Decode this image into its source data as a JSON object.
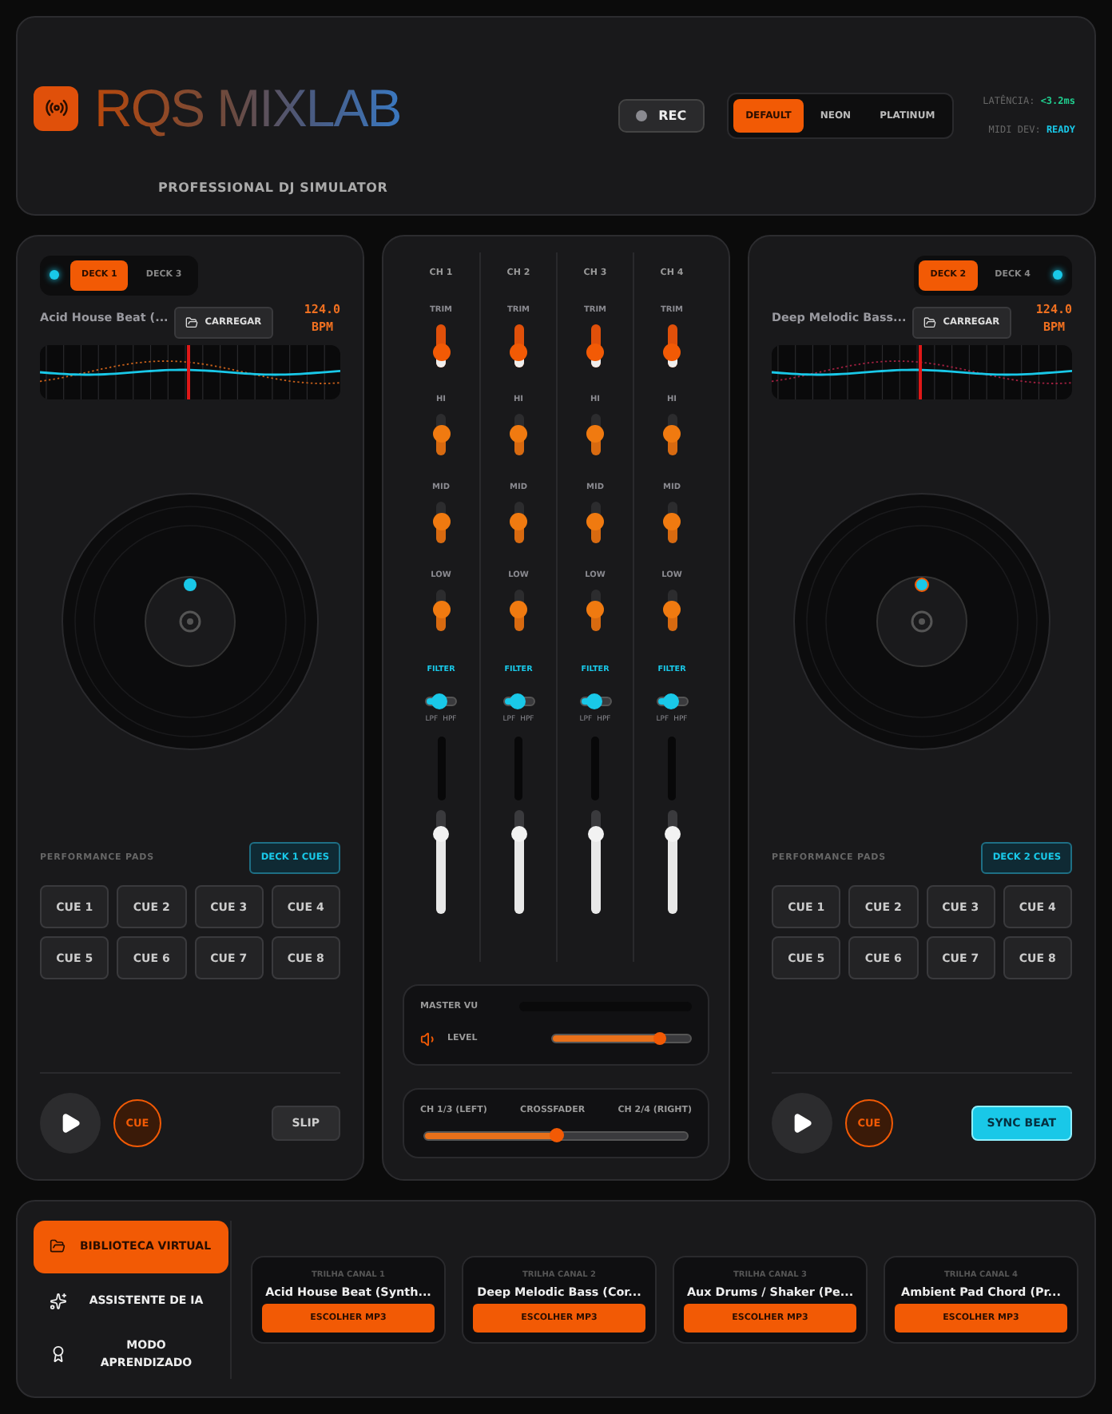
{
  "header": {
    "title": "RQS MIXLAB",
    "subtitle": "PROFESSIONAL DJ SIMULATOR",
    "rec": {
      "label": "REC",
      "recording": false
    },
    "themes": [
      {
        "label": "DEFAULT",
        "selected": true
      },
      {
        "label": "NEON",
        "selected": false
      },
      {
        "label": "PLATINUM",
        "selected": false
      }
    ],
    "latency_label": "LATÊNCIA:",
    "latency_value": "<3.2ms",
    "midi_label": "MIDI DEV:",
    "midi_value": "READY"
  },
  "decks": [
    {
      "tabs": [
        {
          "label": "DECK 1",
          "selected": true
        },
        {
          "label": "DECK 3",
          "selected": false
        }
      ],
      "track": "Acid House Beat (...",
      "load": "CARREGAR",
      "bpm": "124.0",
      "bpm_unit": "BPM",
      "pads_title": "PERFORMANCE PADS",
      "cues_button": "DECK 1 CUES",
      "pads": [
        "CUE 1",
        "CUE 2",
        "CUE 3",
        "CUE 4",
        "CUE 5",
        "CUE 6",
        "CUE 7",
        "CUE 8"
      ],
      "cue": "CUE",
      "action": {
        "label": "SLIP",
        "active": false
      }
    },
    {
      "tabs": [
        {
          "label": "DECK 2",
          "selected": true
        },
        {
          "label": "DECK 4",
          "selected": false
        }
      ],
      "track": "Deep Melodic Bass...",
      "load": "CARREGAR",
      "bpm": "124.0",
      "bpm_unit": "BPM",
      "pads_title": "PERFORMANCE PADS",
      "cues_button": "DECK 2 CUES",
      "pads": [
        "CUE 1",
        "CUE 2",
        "CUE 3",
        "CUE 4",
        "CUE 5",
        "CUE 6",
        "CUE 7",
        "CUE 8"
      ],
      "cue": "CUE",
      "action": {
        "label": "SYNC BEAT",
        "active": true
      }
    }
  ],
  "mixer": {
    "channels": [
      {
        "name": "CH 1",
        "eq": [
          {
            "kind": "trim",
            "label": "TRIM",
            "level": 0.35
          },
          {
            "kind": "eq",
            "label": "HI",
            "level": 0.5
          },
          {
            "kind": "eq",
            "label": "MID",
            "level": 0.5
          },
          {
            "kind": "eq",
            "label": "LOW",
            "level": 0.5
          }
        ],
        "filter": {
          "label": "FILTER",
          "level": 0.45,
          "low": "LPF",
          "high": "HPF"
        },
        "fader": {
          "level": 0.77
        }
      },
      {
        "name": "CH 2",
        "eq": [
          {
            "kind": "trim",
            "label": "TRIM",
            "level": 0.35
          },
          {
            "kind": "eq",
            "label": "HI",
            "level": 0.5
          },
          {
            "kind": "eq",
            "label": "MID",
            "level": 0.5
          },
          {
            "kind": "eq",
            "label": "LOW",
            "level": 0.5
          }
        ],
        "filter": {
          "label": "FILTER",
          "level": 0.45,
          "low": "LPF",
          "high": "HPF"
        },
        "fader": {
          "level": 0.77
        }
      },
      {
        "name": "CH 3",
        "eq": [
          {
            "kind": "trim",
            "label": "TRIM",
            "level": 0.35
          },
          {
            "kind": "eq",
            "label": "HI",
            "level": 0.5
          },
          {
            "kind": "eq",
            "label": "MID",
            "level": 0.5
          },
          {
            "kind": "eq",
            "label": "LOW",
            "level": 0.5
          }
        ],
        "filter": {
          "label": "FILTER",
          "level": 0.45,
          "low": "LPF",
          "high": "HPF"
        },
        "fader": {
          "level": 0.77
        }
      },
      {
        "name": "CH 4",
        "eq": [
          {
            "kind": "trim",
            "label": "TRIM",
            "level": 0.35
          },
          {
            "kind": "eq",
            "label": "HI",
            "level": 0.5
          },
          {
            "kind": "eq",
            "label": "MID",
            "level": 0.5
          },
          {
            "kind": "eq",
            "label": "LOW",
            "level": 0.5
          }
        ],
        "filter": {
          "label": "FILTER",
          "level": 0.45,
          "low": "LPF",
          "high": "HPF"
        },
        "fader": {
          "level": 0.77
        }
      }
    ],
    "master": {
      "label": "MASTER VU",
      "level_label": "LEVEL",
      "level": 0.78
    },
    "crossfader": {
      "left": "CH 1/3 (LEFT)",
      "label": "CROSSFADER",
      "right": "CH 2/4 (RIGHT)",
      "level": 0.5
    }
  },
  "bottom": {
    "nav": [
      {
        "kind": "folder",
        "label": "BIBLIOTECA VIRTUAL",
        "selected": true
      },
      {
        "kind": "sparkles",
        "label": "ASSISTENTE DE IA",
        "selected": false
      },
      {
        "kind": "award",
        "label": "MODO APRENDIZADO",
        "selected": false
      }
    ],
    "tracks": [
      {
        "channel": "TRILHA CANAL 1",
        "title": "Acid House Beat (Synth...",
        "button": "ESCOLHER MP3"
      },
      {
        "channel": "TRILHA CANAL 2",
        "title": "Deep Melodic Bass (Cor...",
        "button": "ESCOLHER MP3"
      },
      {
        "channel": "TRILHA CANAL 3",
        "title": "Aux Drums / Shaker (Pe...",
        "button": "ESCOLHER MP3"
      },
      {
        "channel": "TRILHA CANAL 4",
        "title": "Ambient Pad Chord (Pr...",
        "button": "ESCOLHER MP3"
      }
    ]
  }
}
